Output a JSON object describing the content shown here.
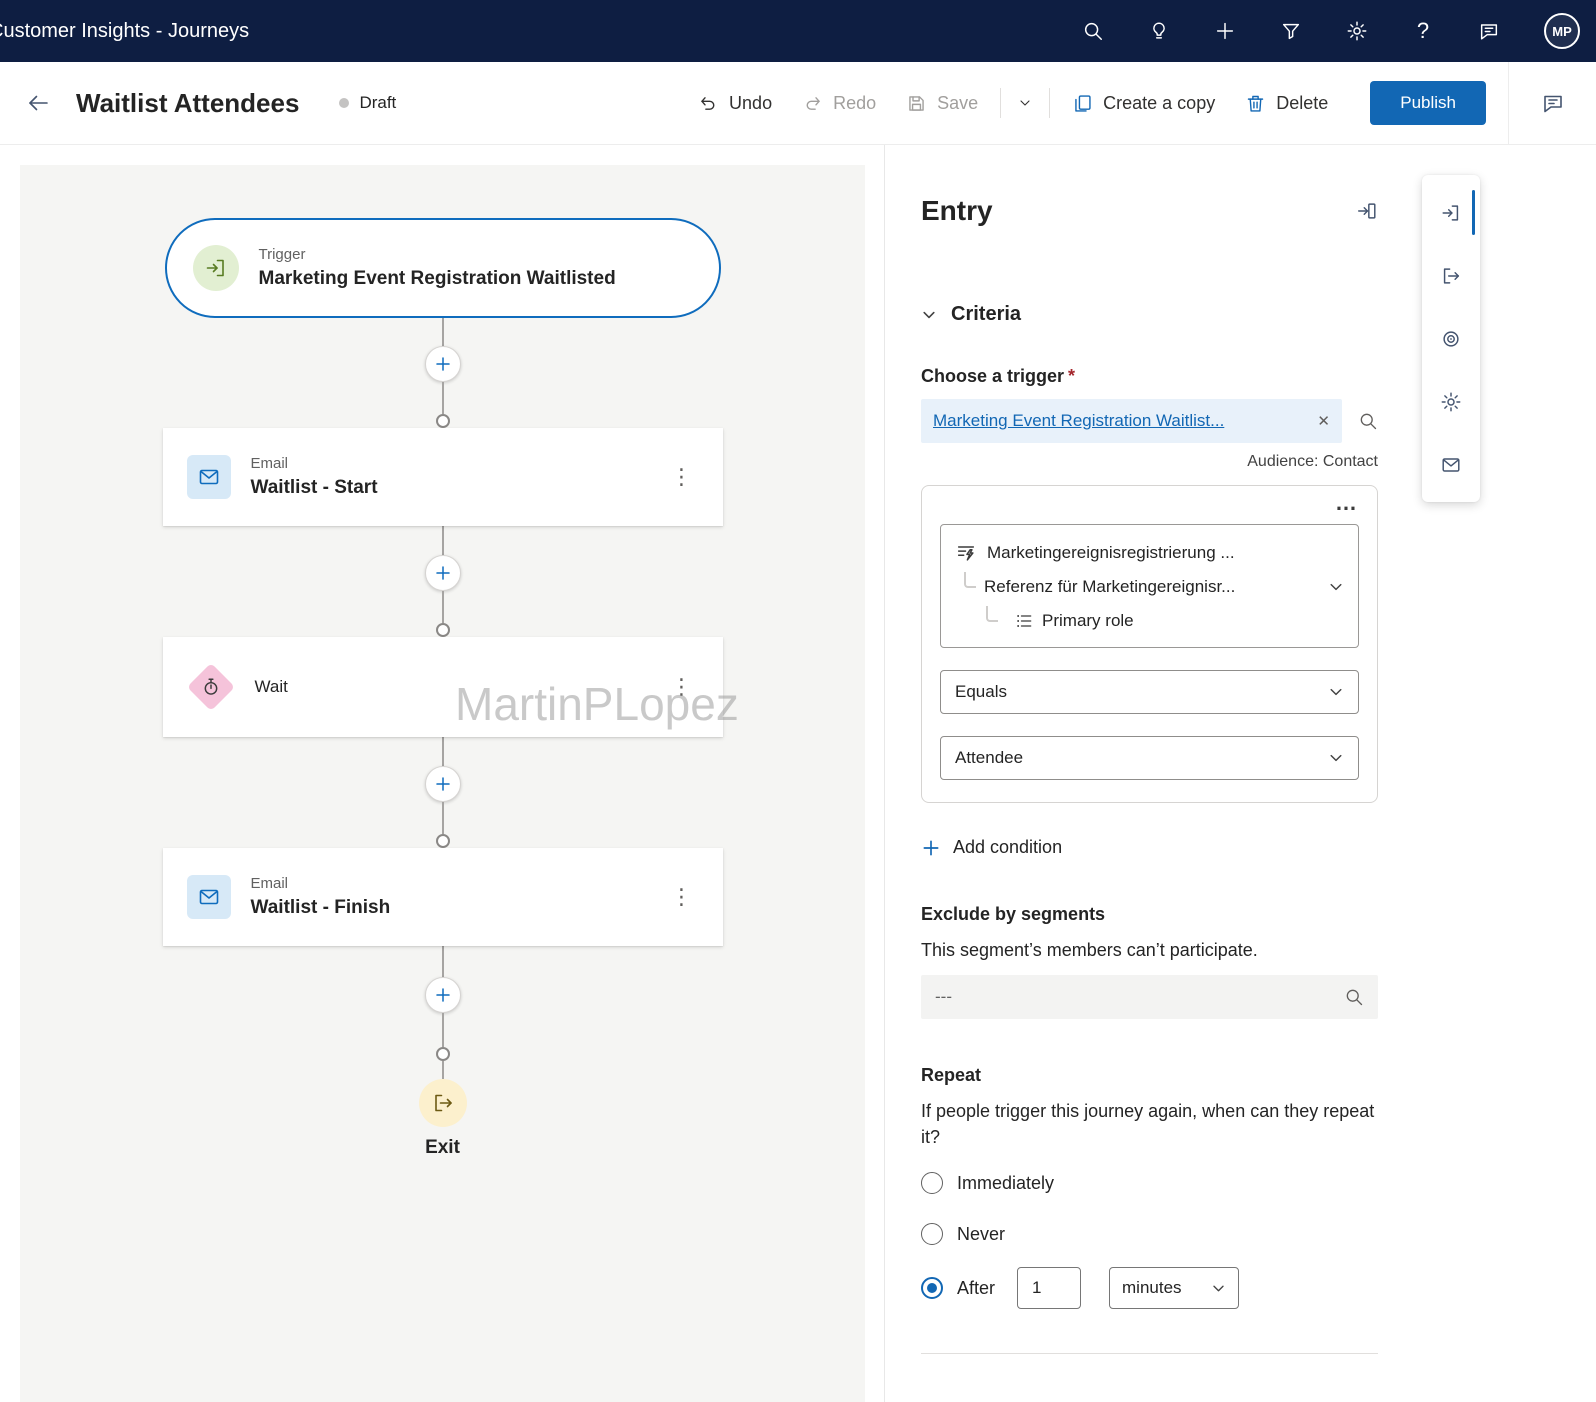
{
  "topbar": {
    "app_title": "Customer Insights - Journeys",
    "avatar_initials": "MP"
  },
  "commandbar": {
    "title": "Waitlist Attendees",
    "status": "Draft",
    "undo": "Undo",
    "redo": "Redo",
    "save": "Save",
    "create_copy": "Create a copy",
    "delete": "Delete",
    "publish": "Publish"
  },
  "canvas": {
    "watermark": "MartinPLopez",
    "nodes": [
      {
        "type_label": "Trigger",
        "title": "Marketing Event Registration Waitlisted"
      },
      {
        "type_label": "Email",
        "title": "Waitlist - Start"
      },
      {
        "type_label": "Wait",
        "title": ""
      },
      {
        "type_label": "Email",
        "title": "Waitlist - Finish"
      }
    ],
    "exit_label": "Exit"
  },
  "panel": {
    "title": "Entry",
    "criteria_label": "Criteria",
    "choose_trigger_label": "Choose a trigger",
    "required_mark": "*",
    "trigger_chip": "Marketing Event Registration Waitlist...",
    "audience": "Audience: Contact",
    "condition": {
      "attribute_root": "Marketingereignisregistrierung ...",
      "attribute_reference": "Referenz für Marketingereignisr...",
      "attribute_leaf": "Primary role",
      "operator": "Equals",
      "value": "Attendee"
    },
    "add_condition": "Add condition",
    "exclude": {
      "heading": "Exclude by segments",
      "description": "This segment’s members can’t participate.",
      "placeholder": "---"
    },
    "repeat": {
      "heading": "Repeat",
      "description": "If people trigger this journey again, when can they repeat it?",
      "options": [
        {
          "label": "Immediately",
          "selected": false
        },
        {
          "label": "Never",
          "selected": false
        },
        {
          "label": "After",
          "selected": true
        }
      ],
      "after_value": "1",
      "after_unit": "minutes"
    }
  },
  "icons": {
    "kebab": "⋮",
    "more": "…",
    "close": "✕"
  },
  "colors": {
    "accent": "#1267b4",
    "topbar_bg": "#0e1e42",
    "required": "#a4262c"
  }
}
